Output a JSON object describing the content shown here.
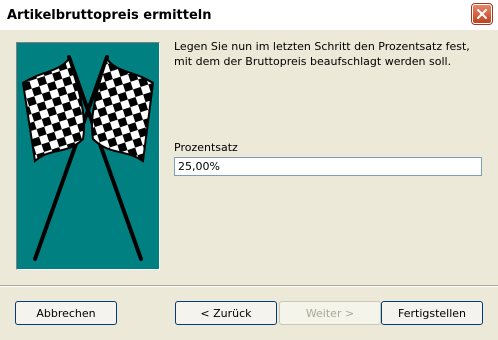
{
  "window": {
    "title": "Artikelbruttopreis ermitteln"
  },
  "image": {
    "icon": "checkered-flags-icon"
  },
  "instruction": "Legen Sie nun im letzten Schritt den Prozentsatz fest, mit dem der Bruttopreis beaufschlagt werden soll.",
  "field": {
    "label": "Prozentsatz",
    "value": "25,00%"
  },
  "buttons": {
    "cancel": "Abbrechen",
    "back": "< Zurück",
    "next": "Weiter >",
    "finish": "Fertigstellen"
  },
  "colors": {
    "panel": "#008080",
    "dialog": "#ece9d8"
  }
}
